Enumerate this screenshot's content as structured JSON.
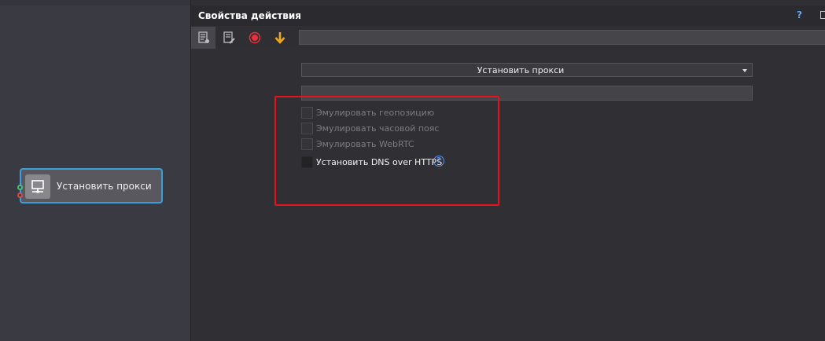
{
  "canvas": {
    "node": {
      "label": "Установить прокси",
      "icon": "network-computer-icon"
    }
  },
  "panel": {
    "title": "Свойства действия",
    "help_label": "?",
    "toolbar": [
      {
        "icon": "properties-icon"
      },
      {
        "icon": "edit-document-icon"
      },
      {
        "icon": "record-icon"
      },
      {
        "icon": "arrow-down-icon"
      }
    ],
    "toolbar_field_value": "",
    "action_select": {
      "value": "Установить прокси"
    },
    "proxy_field_value": "",
    "options": [
      {
        "label": "Эмулировать геопозицию",
        "checked": false,
        "enabled": false
      },
      {
        "label": "Эмулировать часовой пояс",
        "checked": false,
        "enabled": false
      },
      {
        "label": "Эмулировать WebRTC",
        "checked": false,
        "enabled": false
      },
      {
        "label": "Установить DNS over HTTPS",
        "checked": false,
        "enabled": true,
        "help": "?"
      }
    ]
  },
  "colors": {
    "accent_blue": "#3a9fdd",
    "highlight_red": "#e8111d",
    "record_red": "#e8333a",
    "arrow_orange": "#f0a818",
    "help_blue": "#5b8fe8"
  }
}
